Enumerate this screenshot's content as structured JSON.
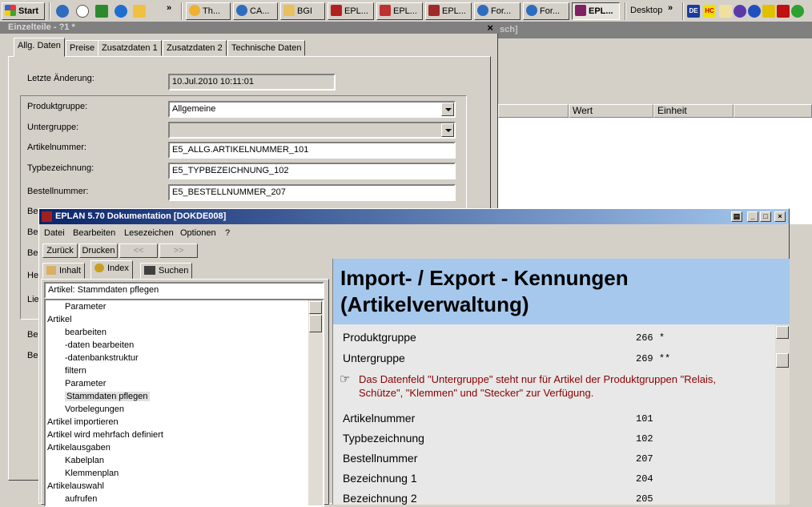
{
  "taskbar": {
    "start_label": "Start",
    "buttons": [
      "Th...",
      "CA...",
      "BGI",
      "EPL...",
      "EPL...",
      "EPL...",
      "For...",
      "For...",
      "EPL..."
    ],
    "desktop_label": "Desktop",
    "expand_label": "»",
    "expand_label2": "»"
  },
  "back_window": {
    "title_fragment": "sch]",
    "col_wert": "Wert",
    "col_einheit": "Einheit"
  },
  "einzelteile": {
    "title": "Einzelteile - ?1 *",
    "close": "×",
    "tabs": [
      "Allg. Daten",
      "Preise",
      "Zusatzdaten 1",
      "Zusatzdaten 2",
      "Technische Daten"
    ],
    "letzte_label": "Letzte Änderung:",
    "letzte_value": "10.Jul.2010 10:11:01",
    "produktgruppe_label": "Produktgruppe:",
    "produktgruppe_value": "Allgemeine",
    "untergruppe_label": "Untergruppe:",
    "untergruppe_value": "",
    "artikelnummer_label": "Artikelnummer:",
    "artikelnummer_value": "E5_ALLG.ARTIKELNUMMER_101",
    "typbezeichnung_label": "Typbezeichnung:",
    "typbezeichnung_value": "E5_TYPBEZEICHNUNG_102",
    "bestellnummer_label": "Bestellnummer:",
    "bestellnummer_value": "E5_BESTELLNUMMER_207",
    "partial_labels": [
      "Be",
      "Be",
      "Be",
      "He",
      "Lie",
      "Be",
      "Be"
    ]
  },
  "help": {
    "title": "EPLAN 5.70  Dokumentation  [DOKDE008]",
    "menu": [
      "Datei",
      "Bearbeiten",
      "Lesezeichen",
      "Optionen",
      "?"
    ],
    "btn_back": "Zurück",
    "btn_print": "Drucken",
    "btn_prev": "<<",
    "btn_next": ">>",
    "tabs": [
      "Inhalt",
      "Index",
      "Suchen"
    ],
    "search_value": "Artikel:  Stammdaten pflegen",
    "tree": [
      {
        "label": "Parameter",
        "indent": 1
      },
      {
        "label": "Artikel",
        "indent": 0
      },
      {
        "label": "bearbeiten",
        "indent": 1
      },
      {
        "label": "-daten bearbeiten",
        "indent": 1
      },
      {
        "label": "-datenbankstruktur",
        "indent": 1
      },
      {
        "label": "filtern",
        "indent": 1
      },
      {
        "label": "Parameter",
        "indent": 1
      },
      {
        "label": "Stammdaten pflegen",
        "indent": 1,
        "selected": true
      },
      {
        "label": "Vorbelegungen",
        "indent": 1
      },
      {
        "label": "Artikel importieren",
        "indent": 0
      },
      {
        "label": "Artikel wird mehrfach definiert",
        "indent": 0
      },
      {
        "label": "Artikelausgaben",
        "indent": 0
      },
      {
        "label": "Kabelplan",
        "indent": 1
      },
      {
        "label": "Klemmenplan",
        "indent": 1
      },
      {
        "label": "Artikelauswahl",
        "indent": 0
      },
      {
        "label": "aufrufen",
        "indent": 1
      }
    ],
    "heading_line1": "Import- / Export - Kennungen",
    "heading_line2": "(Artikelverwaltung)",
    "rows": [
      {
        "name": "Produktgruppe",
        "value": "266",
        "note": "*"
      },
      {
        "name": "Untergruppe",
        "value": "269",
        "note": "**"
      },
      {
        "name": "Artikelnummer",
        "value": "101",
        "note": ""
      },
      {
        "name": "Typbezeichnung",
        "value": "102",
        "note": ""
      },
      {
        "name": "Bestellnummer",
        "value": "207",
        "note": ""
      },
      {
        "name": "Bezeichnung 1",
        "value": "204",
        "note": ""
      },
      {
        "name": "Bezeichnung 2",
        "value": "205",
        "note": ""
      }
    ],
    "note_line1": "Das Datenfeld \"Untergruppe\" steht nur für Artikel der Produktgruppen \"Relais,",
    "note_line2": "Schütze\", \"Klemmen\" und \"Stecker\" zur Verfügung.",
    "note_color": "#8b0000",
    "heading_bg": "#a6c8ec"
  }
}
